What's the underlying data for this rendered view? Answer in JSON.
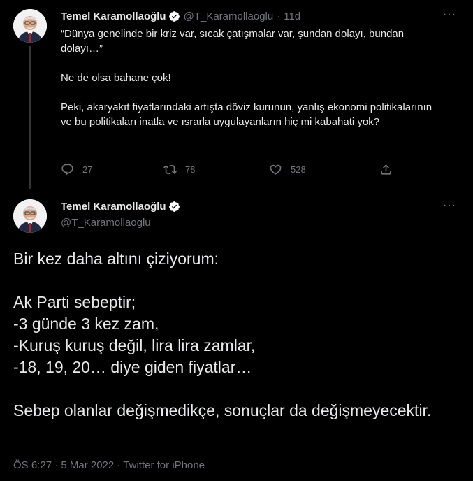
{
  "tweet1": {
    "author_name": "Temel Karamollaoğlu",
    "handle": "@T_Karamollaoglu",
    "separator": "·",
    "time_ago": "11d",
    "paragraphs": [
      "“Dünya genelinde bir kriz var, sıcak çatışmalar var, şundan dolayı, bundan dolayı…”",
      "Ne de olsa bahane çok!",
      "Peki, akaryakıt fiyatlarındaki artışta döviz kurunun, yanlış ekonomi politikalarının ve bu politikaları inatla ve ısrarla uygulayanların hiç mi kabahati yok?"
    ],
    "reply_count": "27",
    "retweet_count": "78",
    "like_count": "528",
    "more_label": "···"
  },
  "tweet2": {
    "author_name": "Temel Karamollaoğlu",
    "handle": "@T_Karamollaoglu",
    "more_label": "···",
    "paragraphs": [
      "Bir kez daha altını çiziyorum:",
      "Ak Parti sebeptir;\n-3 günde 3 kez zam,\n-Kuruş kuruş değil, lira lira zamlar,\n-18, 19, 20… diye giden fiyatlar…",
      "Sebep olanlar değişmedikçe, sonuçlar da değişmeyecektir."
    ],
    "meta": "ÖS 6:27 · 5 Mar 2022 · Twitter for iPhone"
  },
  "colors": {
    "background": "#000000",
    "text": "#e7e9ea",
    "muted": "#71767b",
    "verified": "#ffffff"
  }
}
